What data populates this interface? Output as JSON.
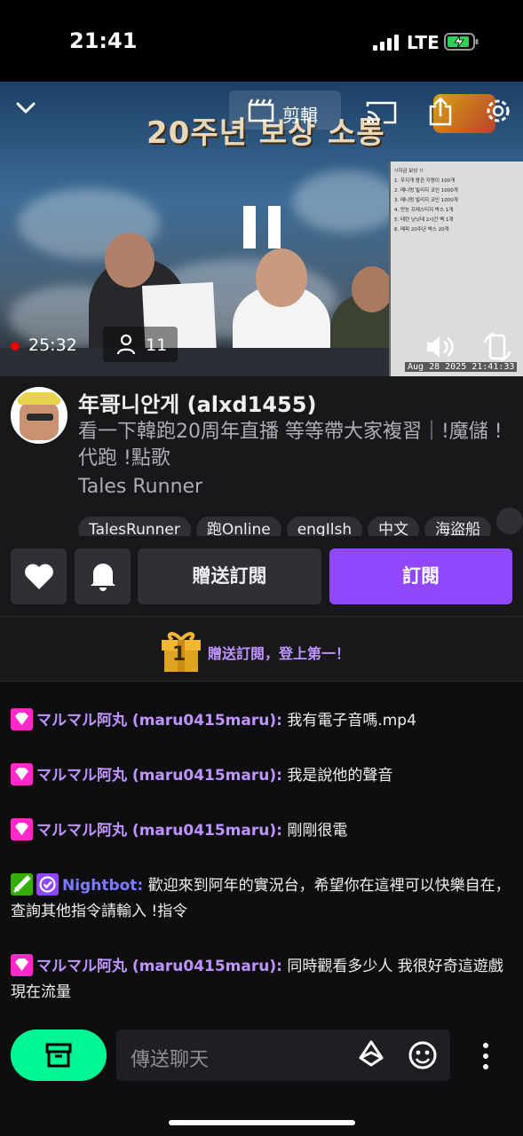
{
  "status_bar": {
    "time": "21:41",
    "network": "LTE"
  },
  "player": {
    "clip_label": "剪輯",
    "live_time": "25:32",
    "viewer_count": "11",
    "banner_text": "20주년 보상 소통",
    "overlay_date": "Aug 28 2025 21:41:33",
    "notice_lines": [
      "!!지금 보상 !!",
      "1. 우지개 왕관 지령이 100개",
      "2. 메니멍 빌리지 코인 1000개",
      "3. 메니멍 빌리지 코인 1000개",
      "4. 만능 프레스티지 박스 1개",
      "5. 테런 닝닛데 2시간 팩 1개",
      "6. 메피 20주년 박스 20개"
    ]
  },
  "channel": {
    "name": "年哥니안게 (alxd1455)",
    "title": "看一下韓跑20周年直播 等等帶大家複習｜!魔儲 !代跑 !點歌",
    "game": "Tales Runner",
    "tags": [
      "TalesRunner",
      "跑Online",
      "engIlsh",
      "中文",
      "海盜船",
      ""
    ],
    "gift_sub_label": "贈送訂閱",
    "subscribe_label": "訂閱"
  },
  "gift_banner": {
    "number": "1",
    "text": "贈送訂閱，登上第一！"
  },
  "chat": {
    "messages": [
      {
        "user": "マルマル阿丸 (maru0415maru):",
        "text": " 我有電子音嗎.mp4",
        "user_color": "#bf94ff",
        "badges": [
          "sub"
        ]
      },
      {
        "user": "マルマル阿丸 (maru0415maru):",
        "text": " 我是說他的聲音",
        "user_color": "#bf94ff",
        "badges": [
          "sub"
        ]
      },
      {
        "user": "マルマル阿丸 (maru0415maru):",
        "text": " 剛剛很電",
        "user_color": "#bf94ff",
        "badges": [
          "sub"
        ]
      },
      {
        "user": "Nightbot:",
        "text": " 歡迎來到阿年的實況台，希望你在這裡可以快樂自在，查詢其他指令請輸入 !指令",
        "user_color": "#7b7bff",
        "badges": [
          "mod",
          "verified"
        ]
      },
      {
        "user": "マルマル阿丸 (maru0415maru):",
        "text": " 同時觀看多少人 我很好奇這遊戲現在流量",
        "user_color": "#bf94ff",
        "badges": [
          "sub"
        ]
      }
    ]
  },
  "input": {
    "placeholder": "傳送聊天"
  },
  "colors": {
    "accent": "#9147ff",
    "store": "#00f593",
    "sub_badge": "#ff2ac8",
    "mod_badge": "#34ae0a"
  }
}
